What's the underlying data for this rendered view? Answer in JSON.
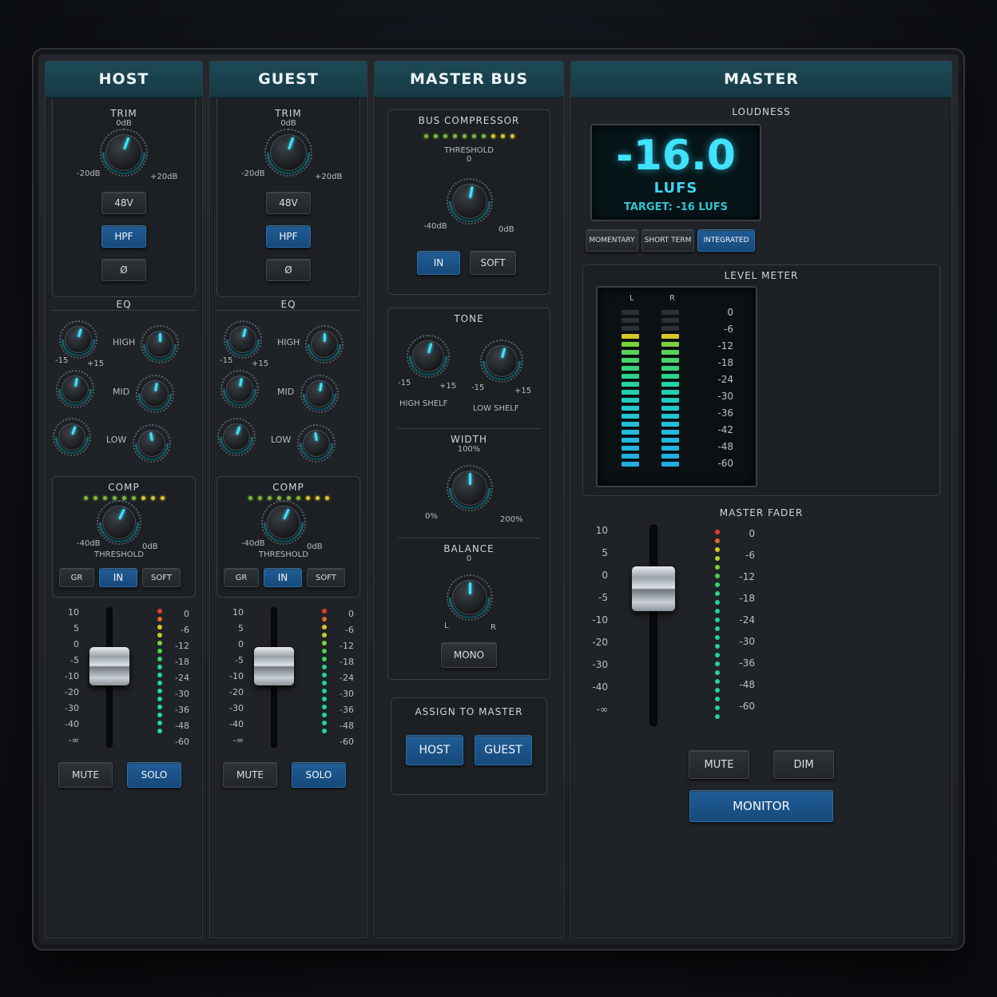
{
  "channels": [
    {
      "name": "HOST",
      "trim": {
        "label": "TRIM",
        "top": "0dB",
        "min": "-20dB",
        "max": "+20dB"
      },
      "buttons": {
        "phantom": "48V",
        "hpf": "HPF",
        "phase": "Ø"
      },
      "eq": {
        "title": "EQ",
        "bands": [
          "HIGH",
          "MID",
          "LOW"
        ],
        "min": "-15",
        "max": "+15"
      },
      "comp": {
        "title": "COMP",
        "min": "-40dB",
        "max": "0dB",
        "knob_label": "THRESHOLD",
        "gr": "GR",
        "in": "IN",
        "soft": "SOFT"
      },
      "fader_scale": [
        "10",
        "5",
        "0",
        "-5",
        "-10",
        "-20",
        "-30",
        "-40",
        "-∞"
      ],
      "meter_scale": [
        "0",
        "-6",
        "-12",
        "-18",
        "-24",
        "-30",
        "-36",
        "-48",
        "-60"
      ],
      "mute": "MUTE",
      "solo": "SOLO"
    },
    {
      "name": "GUEST",
      "trim": {
        "label": "TRIM",
        "top": "0dB",
        "min": "-20dB",
        "max": "+20dB"
      },
      "buttons": {
        "phantom": "48V",
        "hpf": "HPF",
        "phase": "Ø"
      },
      "eq": {
        "title": "EQ",
        "bands": [
          "HIGH",
          "MID",
          "LOW"
        ],
        "min": "-15",
        "max": "+15"
      },
      "comp": {
        "title": "COMP",
        "min": "-40dB",
        "max": "0dB",
        "knob_label": "THRESHOLD",
        "gr": "GR",
        "in": "IN",
        "soft": "SOFT"
      },
      "fader_scale": [
        "10",
        "5",
        "0",
        "-5",
        "-10",
        "-20",
        "-30",
        "-40",
        "-∞"
      ],
      "meter_scale": [
        "0",
        "-6",
        "-12",
        "-18",
        "-24",
        "-30",
        "-36",
        "-48",
        "-60"
      ],
      "mute": "MUTE",
      "solo": "SOLO"
    }
  ],
  "master_bus": {
    "title": "MASTER BUS",
    "bus_comp": {
      "title": "BUS COMPRESSOR",
      "knob_label": "THRESHOLD",
      "top": "0",
      "min": "-40dB",
      "max": "0dB",
      "in": "IN",
      "soft": "SOFT"
    },
    "tone": {
      "title": "TONE",
      "min": "-15",
      "max": "+15",
      "high": "HIGH SHELF",
      "low": "LOW SHELF"
    },
    "width": {
      "title": "WIDTH",
      "top": "100%",
      "min": "0%",
      "max": "200%"
    },
    "balance": {
      "title": "BALANCE",
      "top": "0",
      "left": "L",
      "right": "R",
      "mono": "MONO"
    },
    "assign": {
      "title": "ASSIGN TO MASTER",
      "host": "HOST",
      "guest": "GUEST"
    }
  },
  "master": {
    "title": "MASTER",
    "loudness": {
      "title": "LOUDNESS",
      "value": "-16.0",
      "unit": "LUFS",
      "target": "TARGET: -16 LUFS"
    },
    "modes": {
      "momentary": "MOMENTARY",
      "short_term": "SHORT TERM",
      "integrated": "INTEGRATED"
    },
    "level_meter": {
      "title": "LEVEL METER",
      "left": "L",
      "right": "R",
      "scale": [
        "0",
        "-6",
        "-12",
        "-18",
        "-24",
        "-30",
        "-36",
        "-42",
        "-48",
        "-60"
      ]
    },
    "fader": {
      "title": "MASTER FADER",
      "scale": [
        "10",
        "5",
        "0",
        "-5",
        "-10",
        "-20",
        "-30",
        "-40",
        "-∞"
      ],
      "meter_scale": [
        "0",
        "-6",
        "-12",
        "-18",
        "-24",
        "-30",
        "-36",
        "-48",
        "-60"
      ]
    },
    "mute": "MUTE",
    "dim": "DIM",
    "monitor": "MONITOR"
  },
  "colors": {
    "accent": "#3fe3ff",
    "header": "#1d4a57",
    "active": "#1f5d96",
    "led_green": "#22d3a0",
    "led_yellow": "#d8c52a",
    "led_red": "#e0402a"
  }
}
